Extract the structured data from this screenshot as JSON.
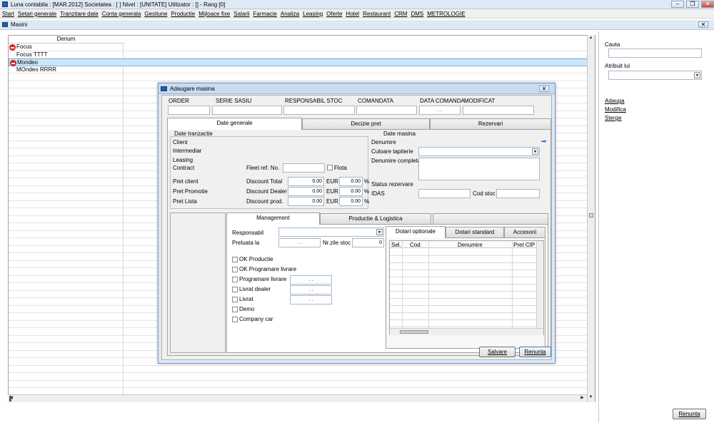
{
  "window": {
    "title": "Luna contabila : [MAR.2012]  Societatea : [                    ] Nivel : [UNITATE] Utilizator : [] - Rang [0]",
    "controls": [
      "–",
      "❐",
      "✕"
    ]
  },
  "menu": [
    "Start",
    "Setari generale",
    "Tranzitare date",
    "Conta generala",
    "Gestiune",
    "Productie",
    "Mijloace fixe",
    "Salarii",
    "Farmacie",
    "Analiza",
    "Leasing",
    "Oferte",
    "Hotel",
    "Restaurant",
    "CRM",
    "DMS",
    "METROLOGIE"
  ],
  "panel": {
    "title": "Masini",
    "close": "✕"
  },
  "grid": {
    "header": "Denum",
    "rows": [
      {
        "text": "Focus",
        "stop": true,
        "selected": false
      },
      {
        "text": "Focus TTTT",
        "stop": false,
        "selected": false
      },
      {
        "text": "Mondeo",
        "stop": true,
        "selected": true
      },
      {
        "text": "MOndeo RRRR",
        "stop": false,
        "selected": false
      }
    ]
  },
  "right": {
    "search_label": "Cauta",
    "attr_label": "Atribuit lui",
    "links": [
      "Adauga",
      "Modifica",
      "Sterge"
    ],
    "cancel": "Renunta"
  },
  "dialog": {
    "title": "Adaugare masina",
    "header_labels": [
      "ORDER",
      "SERIE SASIU",
      "RESPONSABIL STOC",
      "COMANDATA",
      "DATA COMANDA",
      "MODIFICAT"
    ],
    "data_comanda_value": "  .    .",
    "main_tabs": [
      "Date generale",
      "Decizie pret",
      "Rezervari"
    ],
    "tranzactie": {
      "title": "Date tranzactie",
      "labels": [
        "Client",
        "Intermediar",
        "Leasing",
        "Contract"
      ],
      "fleet_label": "Fleet ref. No.",
      "flota_label": "Flota",
      "price_labels": [
        "Pret client",
        "Pret Promotie",
        "Pret Lista"
      ],
      "discount_labels": [
        "Discount Total",
        "Discount Dealer",
        "Discount prod."
      ],
      "amounts": [
        "0.00",
        "0.00",
        "0.00"
      ],
      "currency": "EUR",
      "percents": [
        "0.00",
        "0.00",
        "0.00"
      ],
      "pct_sign": "%"
    },
    "masina": {
      "title": "Date masina",
      "denumire": "Denumire",
      "culoare": "Culoare tapiterie",
      "denumire_completa": "Denumire completa",
      "status": "Status rezervare",
      "idas": "IDAS",
      "cod_stoc": "Cod stoc"
    },
    "sub_tabs": [
      "Management",
      "Productie & Logistica",
      "                 "
    ],
    "management": {
      "responsabil": "Responsabil",
      "preluata": "Preluata la",
      "preluata_value": "  .    .",
      "nr_zile": "Nr.zile stoc",
      "nr_zile_value": "0",
      "checks": [
        {
          "label": "OK Productie",
          "date": null
        },
        {
          "label": "OK Programare livrare",
          "date": null
        },
        {
          "label": "Programare livrare",
          "date": "  .    ."
        },
        {
          "label": "Livrat dealer",
          "date": "  .    ."
        },
        {
          "label": "Livrat",
          "date": "  .    ."
        },
        {
          "label": "Demo",
          "date": null
        },
        {
          "label": "Company car",
          "date": null
        }
      ]
    },
    "dotari_tabs": [
      "Dotari optionale",
      "Dotari standard",
      "Accesorii"
    ],
    "dotari_columns": [
      "Sel.",
      "Cod",
      "Denumire",
      "Pret CIP"
    ],
    "buttons": {
      "save": "Salvare",
      "cancel": "Renunta"
    }
  }
}
